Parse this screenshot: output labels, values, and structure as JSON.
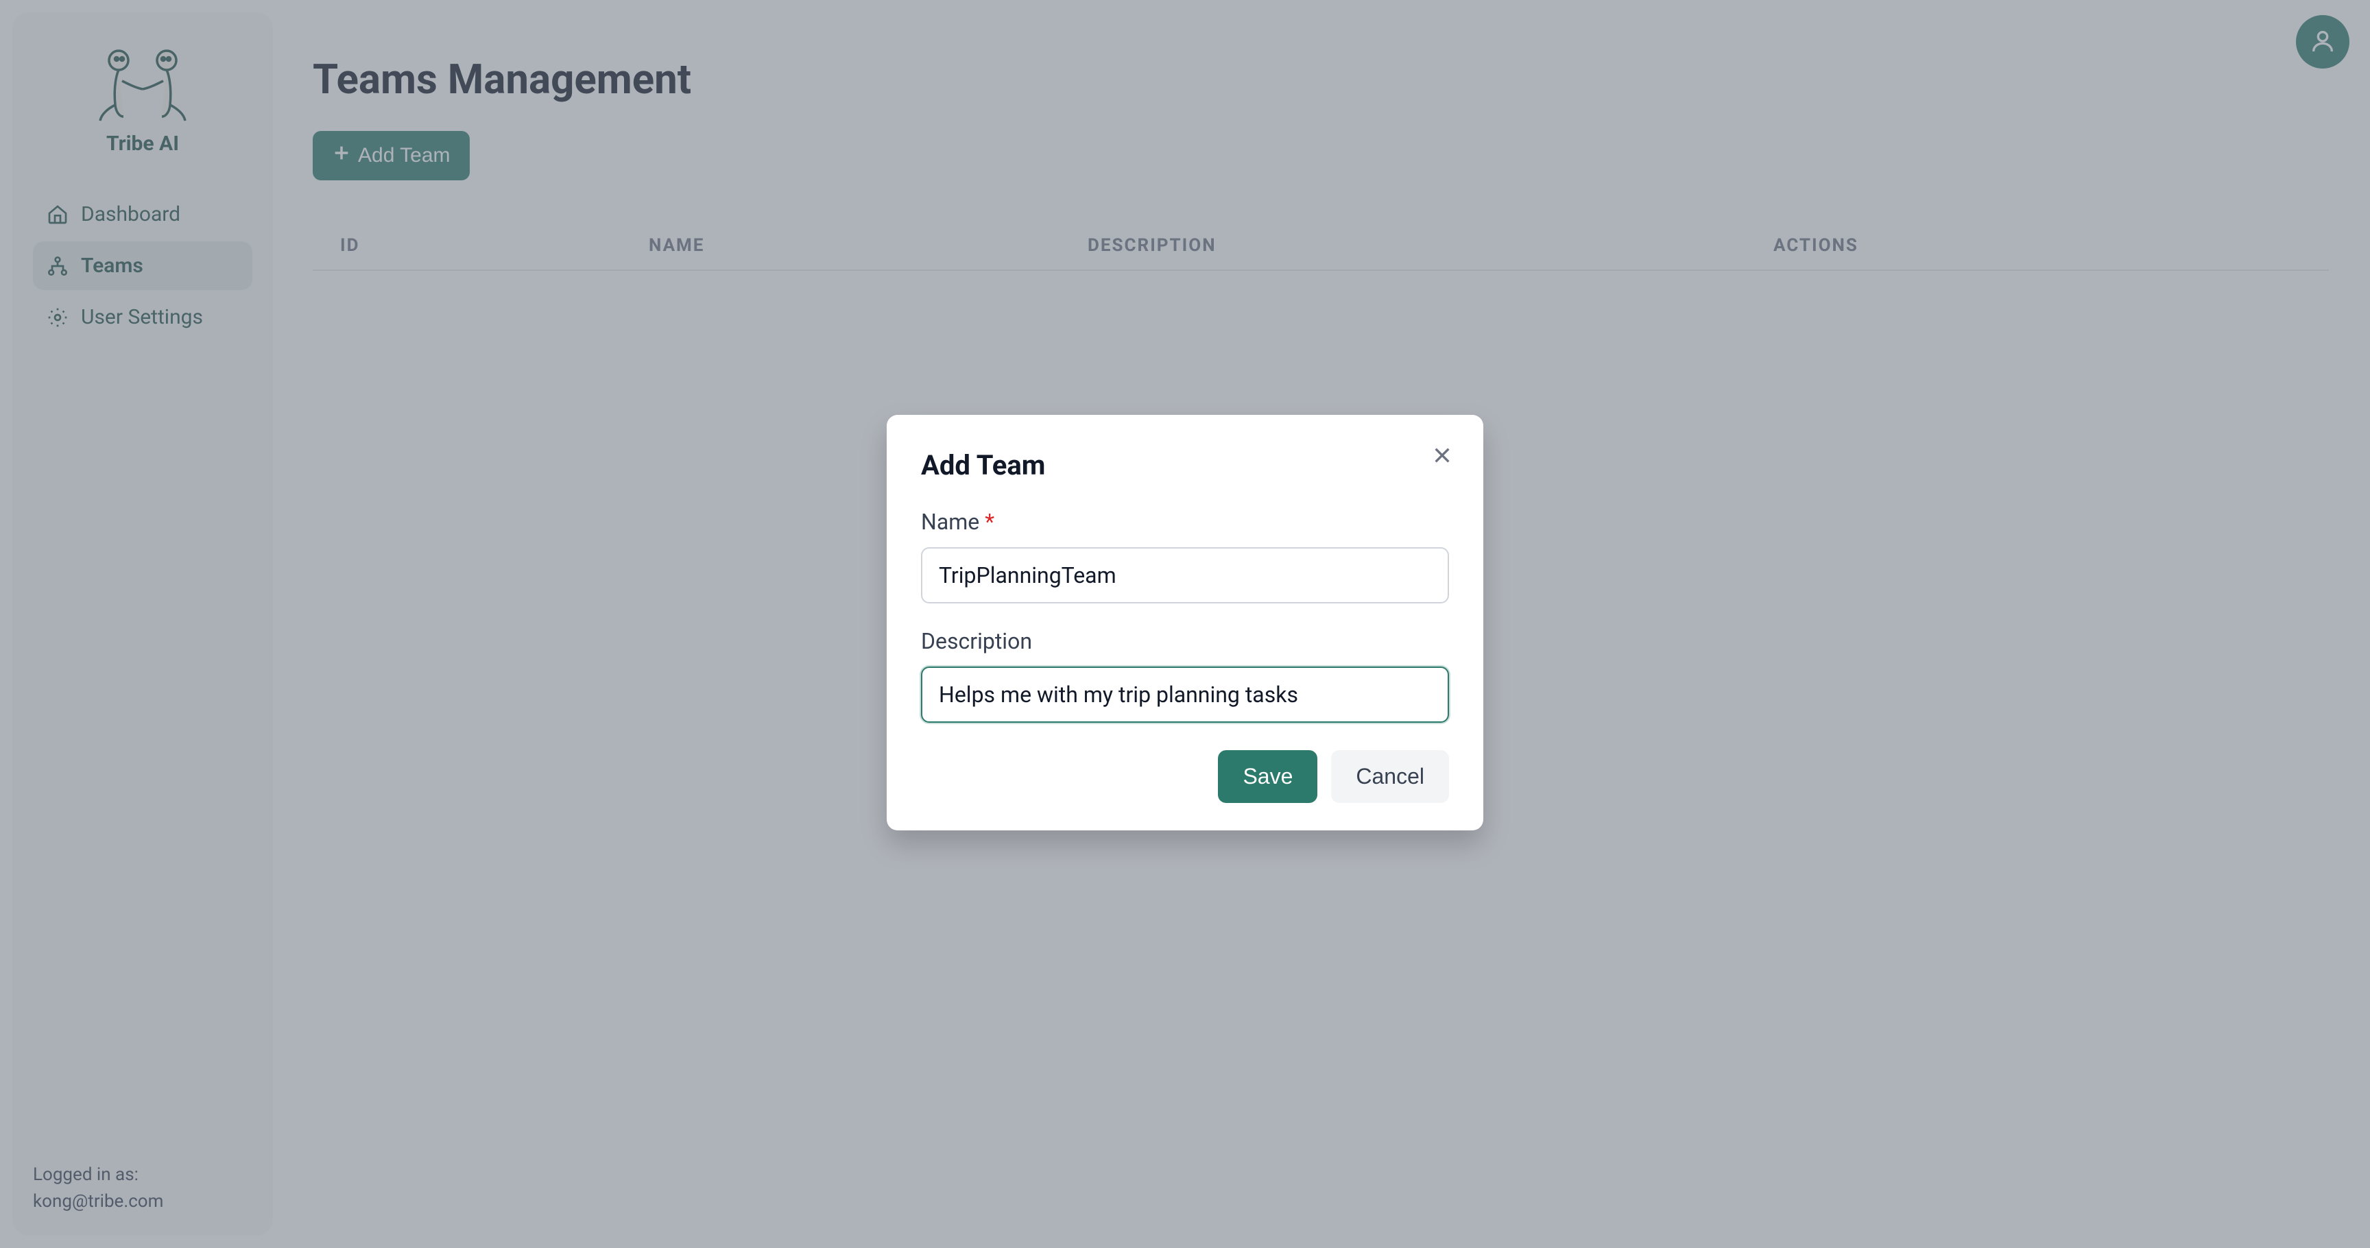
{
  "brand": {
    "name": "Tribe AI"
  },
  "sidebar": {
    "items": [
      {
        "label": "Dashboard"
      },
      {
        "label": "Teams"
      },
      {
        "label": "User Settings"
      }
    ],
    "footer_line1": "Logged in as:",
    "footer_line2": "kong@tribe.com"
  },
  "page": {
    "title": "Teams Management",
    "add_button": "Add Team"
  },
  "table": {
    "headers": {
      "id": "ID",
      "name": "Name",
      "description": "Description",
      "actions": "Actions"
    }
  },
  "modal": {
    "title": "Add Team",
    "name_label": "Name",
    "name_value": "TripPlanningTeam",
    "desc_label": "Description",
    "desc_value": "Helps me with my trip planning tasks",
    "save_label": "Save",
    "cancel_label": "Cancel"
  }
}
